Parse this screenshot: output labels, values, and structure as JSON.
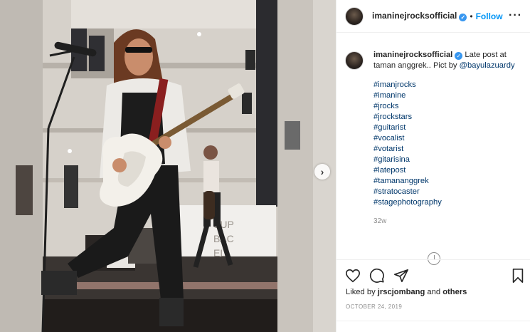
{
  "post": {
    "username": "imaninejrocksofficial",
    "follow_label": "Follow",
    "separator": "•",
    "more_label": "···",
    "caption_text": "Late post at taman anggrek.. Pict by",
    "caption_mention": "@bayulazuardy",
    "hashtags": [
      "#imanjrocks",
      "#imanine",
      "#jrocks",
      "#jrockstars",
      "#guitarist",
      "#vocalist",
      "#votarist",
      "#gitarisina",
      "#latepost",
      "#tamananggrek",
      "#stratocaster",
      "#stagephotography"
    ],
    "time_ago": "32w",
    "liked_prefix": "Liked by",
    "liked_user": "jrscjombang",
    "liked_and": "and",
    "liked_others": "others",
    "date": "OCTOBER 24, 2019",
    "next_glyph": "›"
  },
  "icons": {
    "verified": "verified-badge-icon",
    "like": "heart-icon",
    "comment": "comment-bubble-icon",
    "share": "paper-plane-icon",
    "save": "bookmark-icon",
    "next": "chevron-right-icon",
    "more": "ellipsis-icon"
  },
  "colors": {
    "follow": "#0095f6",
    "verified": "#3897f0",
    "link": "#00376b",
    "muted": "#8e8e8e"
  }
}
